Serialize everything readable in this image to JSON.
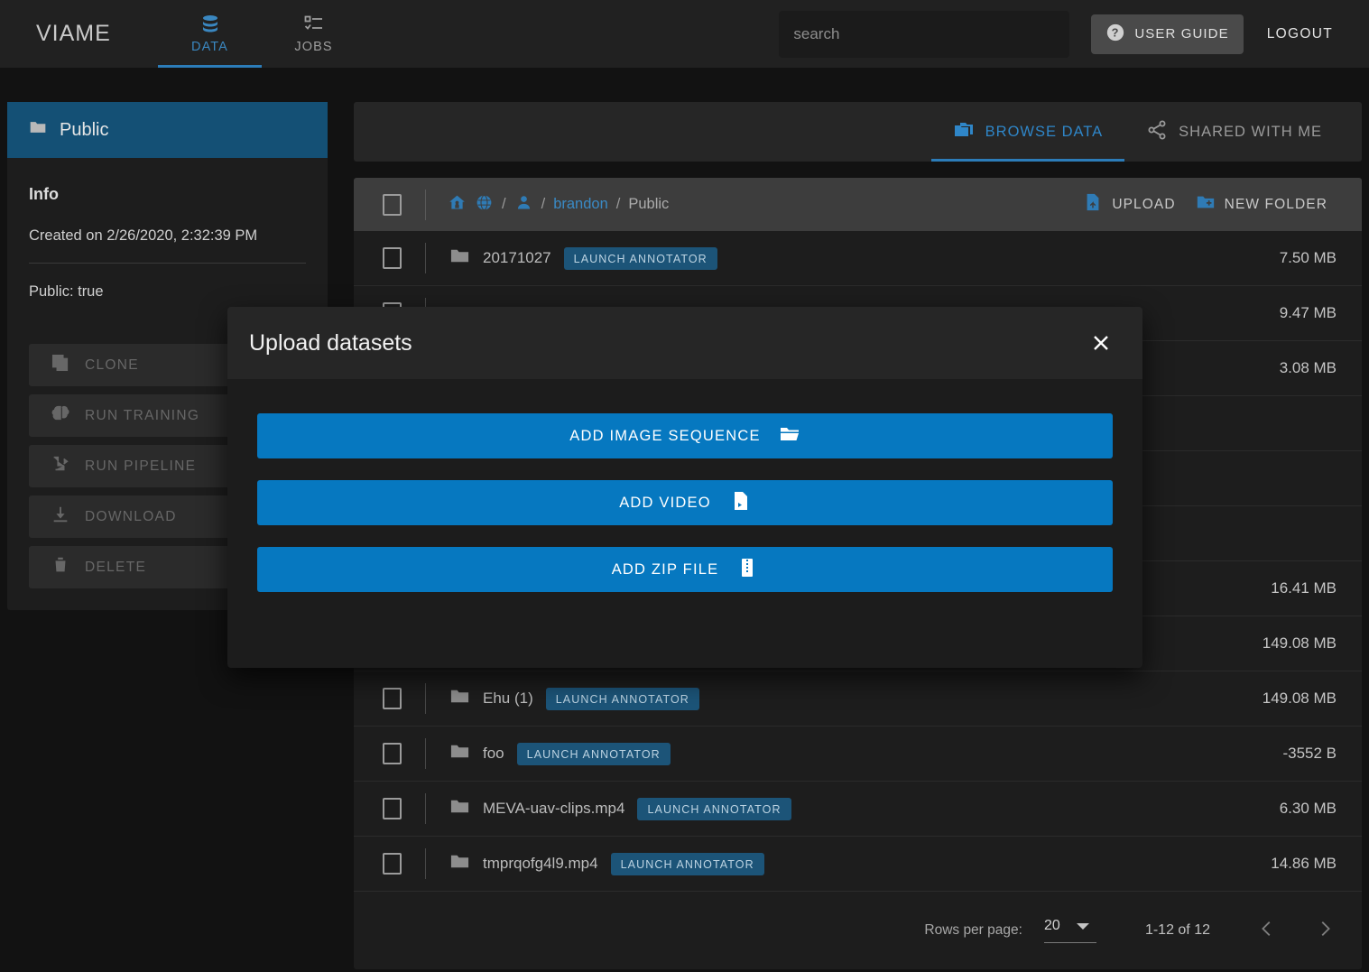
{
  "header": {
    "brand": "VIAME",
    "tabs": [
      {
        "label": "DATA",
        "icon": "database-icon",
        "active": true
      },
      {
        "label": "JOBS",
        "icon": "checklist-icon",
        "active": false
      }
    ],
    "search_placeholder": "search",
    "search_value": "",
    "user_guide_label": "USER GUIDE",
    "logout_label": "LOGOUT"
  },
  "sidebar": {
    "folder_name": "Public",
    "info_title": "Info",
    "created": "Created on 2/26/2020, 2:32:39 PM",
    "public_flag": "Public: true",
    "actions": [
      {
        "label": "CLONE",
        "icon": "copy-icon"
      },
      {
        "label": "RUN TRAINING",
        "icon": "brain-icon"
      },
      {
        "label": "RUN PIPELINE",
        "icon": "pipeline-icon"
      },
      {
        "label": "DOWNLOAD",
        "icon": "download-icon"
      },
      {
        "label": "DELETE",
        "icon": "trash-icon"
      }
    ]
  },
  "panel": {
    "tabs": [
      {
        "label": "BROWSE DATA",
        "icon": "folder-copy-icon",
        "active": true
      },
      {
        "label": "SHARED WITH ME",
        "icon": "share-icon",
        "active": false
      }
    ],
    "breadcrumb": {
      "home_icon": "home-icon",
      "globe_icon": "globe-icon",
      "person_icon": "person-icon",
      "user": "brandon",
      "current": "Public",
      "separator": "/"
    },
    "upload_label": "UPLOAD",
    "new_folder_label": "NEW FOLDER",
    "badge_label": "LAUNCH ANNOTATOR",
    "rows": [
      {
        "name": "20171027",
        "size": "7.50 MB"
      },
      {
        "name": "",
        "size": "9.47 MB"
      },
      {
        "name": "",
        "size": "3.08 MB"
      },
      {
        "name": "",
        "size": ""
      },
      {
        "name": "",
        "size": ""
      },
      {
        "name": "",
        "size": ""
      },
      {
        "name": "",
        "size": "16.41 MB"
      },
      {
        "name": "",
        "size": "149.08 MB"
      },
      {
        "name": "Ehu (1)",
        "size": "149.08 MB"
      },
      {
        "name": "foo",
        "size": "-3552 B"
      },
      {
        "name": "MEVA-uav-clips.mp4",
        "size": "6.30 MB"
      },
      {
        "name": "tmprqofg4l9.mp4",
        "size": "14.86 MB"
      }
    ],
    "pager": {
      "rows_per_page_label": "Rows per page:",
      "rows_per_page_value": "20",
      "range": "1-12 of 12"
    }
  },
  "modal": {
    "title": "Upload datasets",
    "close_icon": "close-icon",
    "buttons": [
      {
        "label": "ADD IMAGE SEQUENCE",
        "icon": "folder-open-icon"
      },
      {
        "label": "ADD VIDEO",
        "icon": "video-file-icon"
      },
      {
        "label": "ADD ZIP FILE",
        "icon": "zip-file-icon"
      }
    ]
  },
  "colors": {
    "accent_blue": "#0678c0",
    "tab_blue": "#2c7cb8",
    "sidebar_header_blue": "#145075",
    "badge_blue": "#1c5478",
    "bg_dark": "#121212",
    "panel_bg": "#1d1d1d"
  }
}
